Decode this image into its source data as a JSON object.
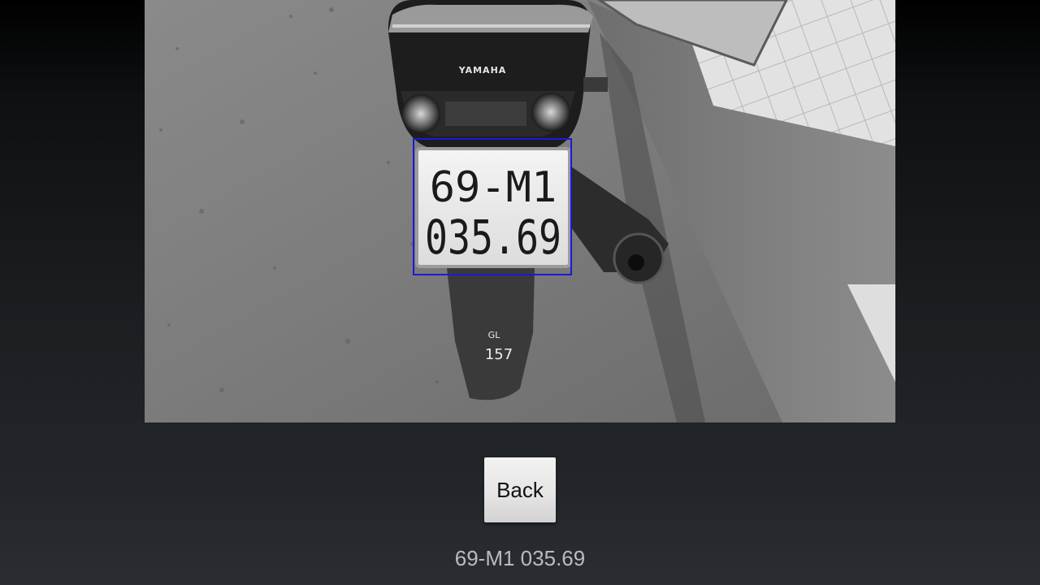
{
  "photo": {
    "motorbike_brand": "YAMAHA",
    "plate_line1": "69-M1",
    "plate_line2": "035.69",
    "fender_mark_line1": "GL",
    "fender_mark_line2": "157",
    "detection_box_color": "#1a1ad8"
  },
  "controls": {
    "back_label": "Back"
  },
  "result": {
    "plate_text": "69-M1 035.69"
  },
  "colors": {
    "button_face": "#e6e6e6",
    "result_text": "#b9bcbf",
    "background_bottom": "#2a2e33"
  },
  "icons": {
    "detection": "bounding-box"
  }
}
